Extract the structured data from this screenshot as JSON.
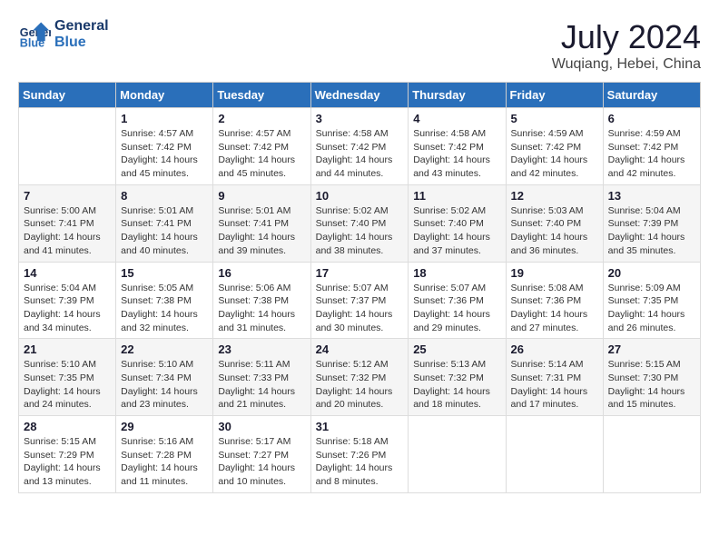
{
  "logo": {
    "line1": "General",
    "line2": "Blue"
  },
  "title": {
    "month_year": "July 2024",
    "location": "Wuqiang, Hebei, China"
  },
  "weekdays": [
    "Sunday",
    "Monday",
    "Tuesday",
    "Wednesday",
    "Thursday",
    "Friday",
    "Saturday"
  ],
  "weeks": [
    [
      {
        "day": "",
        "sunrise": "",
        "sunset": "",
        "daylight": ""
      },
      {
        "day": "1",
        "sunrise": "Sunrise: 4:57 AM",
        "sunset": "Sunset: 7:42 PM",
        "daylight": "Daylight: 14 hours and 45 minutes."
      },
      {
        "day": "2",
        "sunrise": "Sunrise: 4:57 AM",
        "sunset": "Sunset: 7:42 PM",
        "daylight": "Daylight: 14 hours and 45 minutes."
      },
      {
        "day": "3",
        "sunrise": "Sunrise: 4:58 AM",
        "sunset": "Sunset: 7:42 PM",
        "daylight": "Daylight: 14 hours and 44 minutes."
      },
      {
        "day": "4",
        "sunrise": "Sunrise: 4:58 AM",
        "sunset": "Sunset: 7:42 PM",
        "daylight": "Daylight: 14 hours and 43 minutes."
      },
      {
        "day": "5",
        "sunrise": "Sunrise: 4:59 AM",
        "sunset": "Sunset: 7:42 PM",
        "daylight": "Daylight: 14 hours and 42 minutes."
      },
      {
        "day": "6",
        "sunrise": "Sunrise: 4:59 AM",
        "sunset": "Sunset: 7:42 PM",
        "daylight": "Daylight: 14 hours and 42 minutes."
      }
    ],
    [
      {
        "day": "7",
        "sunrise": "Sunrise: 5:00 AM",
        "sunset": "Sunset: 7:41 PM",
        "daylight": "Daylight: 14 hours and 41 minutes."
      },
      {
        "day": "8",
        "sunrise": "Sunrise: 5:01 AM",
        "sunset": "Sunset: 7:41 PM",
        "daylight": "Daylight: 14 hours and 40 minutes."
      },
      {
        "day": "9",
        "sunrise": "Sunrise: 5:01 AM",
        "sunset": "Sunset: 7:41 PM",
        "daylight": "Daylight: 14 hours and 39 minutes."
      },
      {
        "day": "10",
        "sunrise": "Sunrise: 5:02 AM",
        "sunset": "Sunset: 7:40 PM",
        "daylight": "Daylight: 14 hours and 38 minutes."
      },
      {
        "day": "11",
        "sunrise": "Sunrise: 5:02 AM",
        "sunset": "Sunset: 7:40 PM",
        "daylight": "Daylight: 14 hours and 37 minutes."
      },
      {
        "day": "12",
        "sunrise": "Sunrise: 5:03 AM",
        "sunset": "Sunset: 7:40 PM",
        "daylight": "Daylight: 14 hours and 36 minutes."
      },
      {
        "day": "13",
        "sunrise": "Sunrise: 5:04 AM",
        "sunset": "Sunset: 7:39 PM",
        "daylight": "Daylight: 14 hours and 35 minutes."
      }
    ],
    [
      {
        "day": "14",
        "sunrise": "Sunrise: 5:04 AM",
        "sunset": "Sunset: 7:39 PM",
        "daylight": "Daylight: 14 hours and 34 minutes."
      },
      {
        "day": "15",
        "sunrise": "Sunrise: 5:05 AM",
        "sunset": "Sunset: 7:38 PM",
        "daylight": "Daylight: 14 hours and 32 minutes."
      },
      {
        "day": "16",
        "sunrise": "Sunrise: 5:06 AM",
        "sunset": "Sunset: 7:38 PM",
        "daylight": "Daylight: 14 hours and 31 minutes."
      },
      {
        "day": "17",
        "sunrise": "Sunrise: 5:07 AM",
        "sunset": "Sunset: 7:37 PM",
        "daylight": "Daylight: 14 hours and 30 minutes."
      },
      {
        "day": "18",
        "sunrise": "Sunrise: 5:07 AM",
        "sunset": "Sunset: 7:36 PM",
        "daylight": "Daylight: 14 hours and 29 minutes."
      },
      {
        "day": "19",
        "sunrise": "Sunrise: 5:08 AM",
        "sunset": "Sunset: 7:36 PM",
        "daylight": "Daylight: 14 hours and 27 minutes."
      },
      {
        "day": "20",
        "sunrise": "Sunrise: 5:09 AM",
        "sunset": "Sunset: 7:35 PM",
        "daylight": "Daylight: 14 hours and 26 minutes."
      }
    ],
    [
      {
        "day": "21",
        "sunrise": "Sunrise: 5:10 AM",
        "sunset": "Sunset: 7:35 PM",
        "daylight": "Daylight: 14 hours and 24 minutes."
      },
      {
        "day": "22",
        "sunrise": "Sunrise: 5:10 AM",
        "sunset": "Sunset: 7:34 PM",
        "daylight": "Daylight: 14 hours and 23 minutes."
      },
      {
        "day": "23",
        "sunrise": "Sunrise: 5:11 AM",
        "sunset": "Sunset: 7:33 PM",
        "daylight": "Daylight: 14 hours and 21 minutes."
      },
      {
        "day": "24",
        "sunrise": "Sunrise: 5:12 AM",
        "sunset": "Sunset: 7:32 PM",
        "daylight": "Daylight: 14 hours and 20 minutes."
      },
      {
        "day": "25",
        "sunrise": "Sunrise: 5:13 AM",
        "sunset": "Sunset: 7:32 PM",
        "daylight": "Daylight: 14 hours and 18 minutes."
      },
      {
        "day": "26",
        "sunrise": "Sunrise: 5:14 AM",
        "sunset": "Sunset: 7:31 PM",
        "daylight": "Daylight: 14 hours and 17 minutes."
      },
      {
        "day": "27",
        "sunrise": "Sunrise: 5:15 AM",
        "sunset": "Sunset: 7:30 PM",
        "daylight": "Daylight: 14 hours and 15 minutes."
      }
    ],
    [
      {
        "day": "28",
        "sunrise": "Sunrise: 5:15 AM",
        "sunset": "Sunset: 7:29 PM",
        "daylight": "Daylight: 14 hours and 13 minutes."
      },
      {
        "day": "29",
        "sunrise": "Sunrise: 5:16 AM",
        "sunset": "Sunset: 7:28 PM",
        "daylight": "Daylight: 14 hours and 11 minutes."
      },
      {
        "day": "30",
        "sunrise": "Sunrise: 5:17 AM",
        "sunset": "Sunset: 7:27 PM",
        "daylight": "Daylight: 14 hours and 10 minutes."
      },
      {
        "day": "31",
        "sunrise": "Sunrise: 5:18 AM",
        "sunset": "Sunset: 7:26 PM",
        "daylight": "Daylight: 14 hours and 8 minutes."
      },
      {
        "day": "",
        "sunrise": "",
        "sunset": "",
        "daylight": ""
      },
      {
        "day": "",
        "sunrise": "",
        "sunset": "",
        "daylight": ""
      },
      {
        "day": "",
        "sunrise": "",
        "sunset": "",
        "daylight": ""
      }
    ]
  ]
}
